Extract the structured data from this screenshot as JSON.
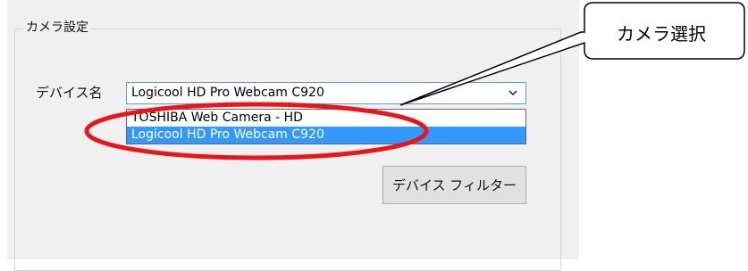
{
  "group": {
    "title": "カメラ設定"
  },
  "device": {
    "label": "デバイス名",
    "selected_value": "Logicool HD Pro Webcam C920",
    "options": [
      "TOSHIBA Web Camera - HD",
      "Logicool HD Pro Webcam C920"
    ],
    "highlighted_option_index": 1
  },
  "buttons": {
    "device_filter": "デバイス フィルター"
  },
  "callout": {
    "text": "カメラ選択"
  },
  "colors": {
    "highlight": "#3399ff",
    "annotation_ring": "#e8151b",
    "panel_bg": "#f0f0f0"
  },
  "icons": {
    "dropdown": "chevron-down-icon"
  }
}
